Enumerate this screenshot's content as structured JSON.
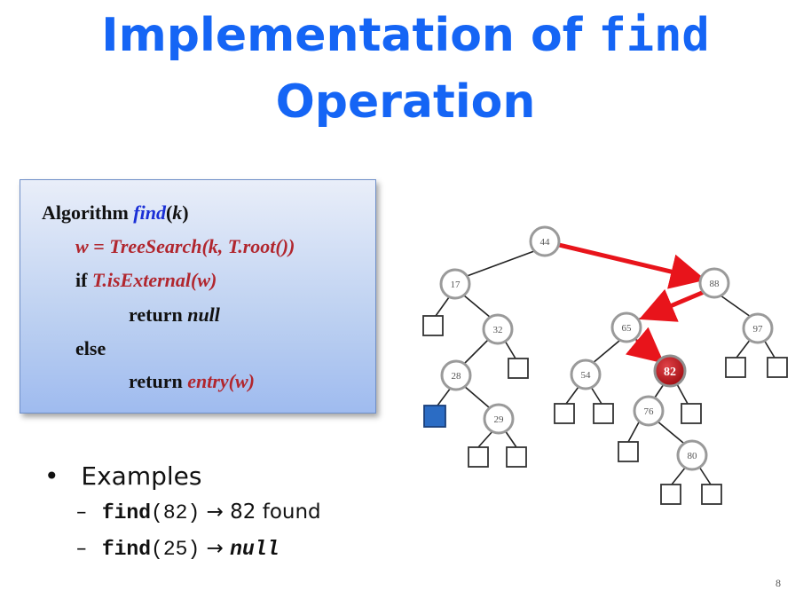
{
  "slide": {
    "title_line1_prefix": "Implementation of ",
    "title_line1_code": "find",
    "title_line2": "Operation",
    "page_number": "8"
  },
  "algorithm": {
    "keyword_algorithm": "Algorithm",
    "fn_name": "find",
    "param_open": "(",
    "param": "k",
    "param_close": ")",
    "line2": "w = TreeSearch(k, T.root())",
    "if_kw": "if",
    "line3_cond": "T.isExternal(w)",
    "return_kw": "return",
    "null_kw": "null",
    "else_kw": "else",
    "entry_call": "entry(w)"
  },
  "examples": {
    "bullet": "•",
    "heading": "Examples",
    "dash": "–",
    "ex1_code": "find",
    "ex1_args": "(82)",
    "arrow": "→",
    "ex1_result": "82 found",
    "ex2_code": "find",
    "ex2_args": "(25)",
    "ex2_result": "null"
  },
  "tree": {
    "nodes": [
      "44",
      "17",
      "88",
      "32",
      "65",
      "97",
      "28",
      "54",
      "82",
      "29",
      "76",
      "80"
    ],
    "highlighted_node": "82",
    "search_path": [
      "44",
      "88",
      "65",
      "82"
    ],
    "colors": {
      "path_arrow": "#e8141b",
      "found_node": "#c0141b",
      "external_highlight": "#2b6cc4",
      "node_stroke": "#9a9a9a"
    }
  }
}
